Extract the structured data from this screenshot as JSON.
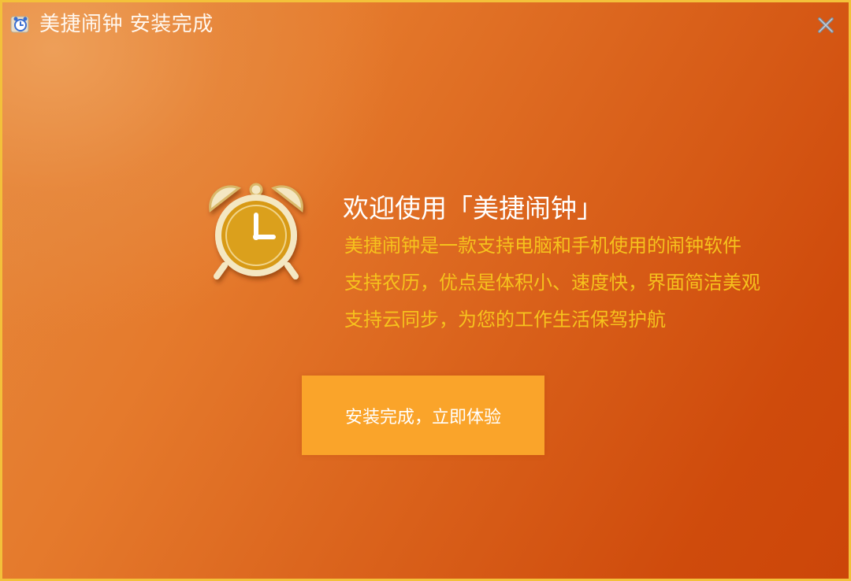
{
  "window": {
    "title": "美捷闹钟 安装完成",
    "app_icon": "alarm-clock-app-icon",
    "close_icon": "close-icon"
  },
  "content": {
    "logo_icon": "alarm-clock-icon",
    "welcome": "欢迎使用「美捷闹钟」",
    "description": [
      "美捷闹钟是一款支持电脑和手机使用的闹钟软件",
      "支持农历，优点是体积小、速度快，界面简洁美观",
      "支持云同步，为您的工作生活保驾护航"
    ],
    "finish_button": "安装完成，立即体验"
  },
  "colors": {
    "border": "#f3c13a",
    "background_start": "#e68a3e",
    "background_end": "#cc4609",
    "description_text": "#f6c21d",
    "button": "#faa42a"
  }
}
